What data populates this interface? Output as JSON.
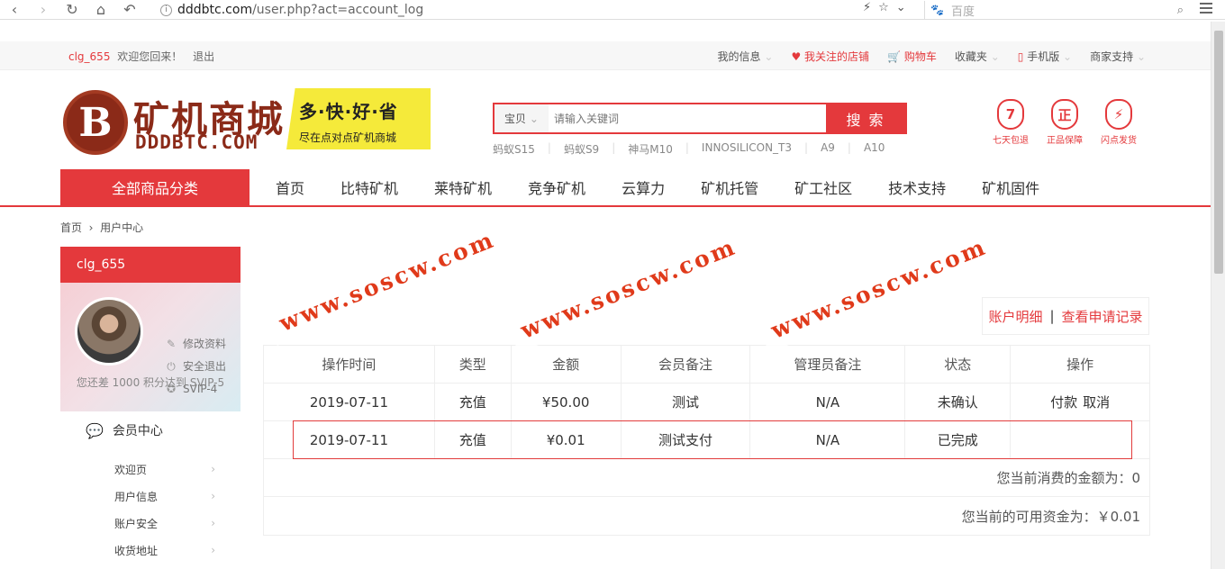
{
  "browser": {
    "url_domain": "dddbtc.com",
    "url_path": "/user.php?act=account_log",
    "search_placeholder": "百度"
  },
  "topbar": {
    "username": "clg_655",
    "welcome": "欢迎您回来！",
    "logout": "退出",
    "links": [
      "我的信息",
      "我关注的店铺",
      "购物车",
      "收藏夹",
      "手机版",
      "商家支持"
    ]
  },
  "logo": {
    "brand": "矿机商城",
    "domain": "DDDBTC.COM",
    "slogan": "多·快·好·省",
    "sub": "尽在点对点矿机商城"
  },
  "search": {
    "category": "宝贝",
    "placeholder": "请输入关键词",
    "button": "搜 索",
    "hotwords": [
      "蚂蚁S15",
      "蚂蚁S9",
      "神马M10",
      "INNOSILICON_T3",
      "A9",
      "A10"
    ]
  },
  "badges": [
    {
      "icon": "7",
      "label": "七天包退"
    },
    {
      "icon": "正",
      "label": "正品保障"
    },
    {
      "icon": "⚡",
      "label": "闪点发货"
    }
  ],
  "nav": {
    "all_categories": "全部商品分类",
    "links": [
      "首页",
      "比特矿机",
      "莱特矿机",
      "竞争矿机",
      "云算力",
      "矿机托管",
      "矿工社区",
      "技术支持",
      "矿机固件"
    ]
  },
  "breadcrumb": {
    "home": "首页",
    "current": "用户中心"
  },
  "sidebar": {
    "username": "clg_655",
    "links": [
      "修改资料",
      "安全退出",
      "SVIP-4"
    ],
    "tip": "您还差 1000 积分达到 SVIP-5",
    "menu_title": "会员中心",
    "items": [
      "欢迎页",
      "用户信息",
      "账户安全",
      "收货地址"
    ]
  },
  "tabs": {
    "account_detail": "账户明细",
    "apply_records": "查看申请记录"
  },
  "table": {
    "headers": [
      "操作时间",
      "类型",
      "金额",
      "会员备注",
      "管理员备注",
      "状态",
      "操作"
    ],
    "rows": [
      [
        "2019-07-11",
        "充值",
        "¥50.00",
        "测试",
        "N/A",
        "未确认",
        "付款",
        "取消"
      ],
      [
        "2019-07-11",
        "充值",
        "¥0.01",
        "测试支付",
        "N/A",
        "已完成",
        "",
        ""
      ]
    ],
    "summary_spent": "您当前消费的金额为：0",
    "summary_balance": "您当前的可用资金为：￥0.01"
  },
  "watermark": "www.soscw.com",
  "colors": {
    "accent": "#e4393c",
    "promo": "#f5ea3a",
    "brand": "#8b2a18"
  }
}
